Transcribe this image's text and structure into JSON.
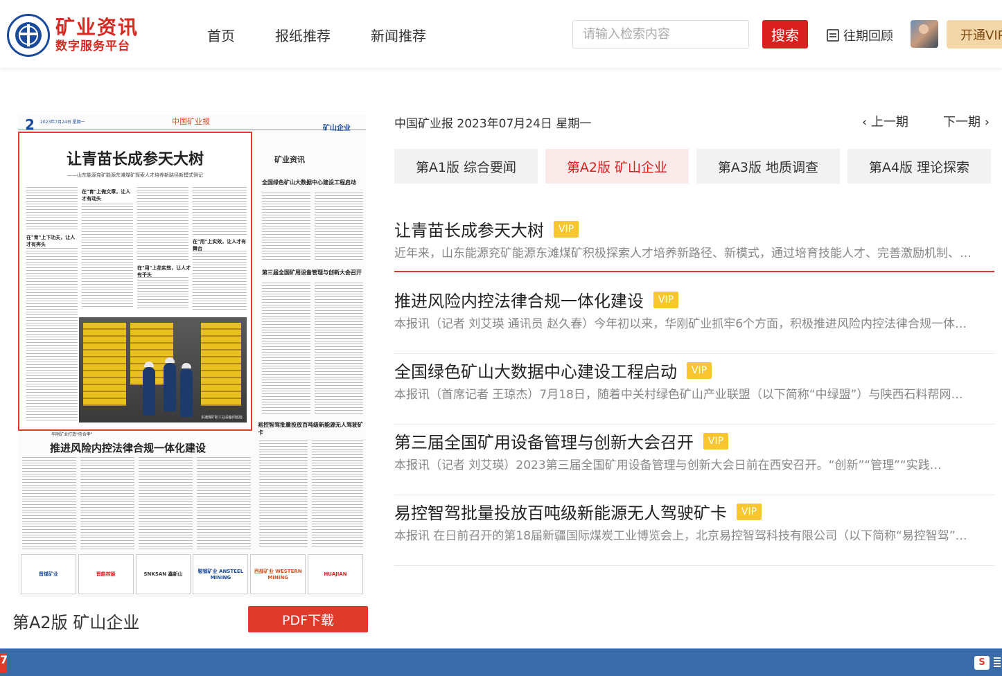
{
  "header": {
    "logo_title": "矿业资讯",
    "logo_sub": "数字服务平台",
    "nav": [
      {
        "label": "首页"
      },
      {
        "label": "报纸推荐"
      },
      {
        "label": "新闻推荐"
      }
    ],
    "search_placeholder": "请输入检索内容",
    "search_button": "搜索",
    "archive_label": "往期回顾",
    "vip_button": "开通VIP"
  },
  "paper": {
    "page_num": "2",
    "date_line": "2023年7月24日  星期一",
    "masthead": "中国矿业报",
    "section_tag": "矿山企业",
    "headline": "让青苗长成参天大树",
    "subhead": "——山东能源兖矿能源东滩煤矿探索人才培养新路径新模式侧记",
    "right_logo": "矿业资讯",
    "right_col_title_1": "全国绿色矿山大数据中心建设工程启动",
    "right_col_title_2": "第三届全国矿用设备管理与创新大会召开",
    "right_col_title_3": "易控智驾批量投放百吨级新能源无人驾驶矿卡",
    "col_head_1": "在\"育\"上做文章，让人才有动头",
    "col_head_2": "在\"育\"上下功夫，让人才有奔头",
    "col_head_3": "在\"用\"上实效，让人才有舞台",
    "col_head_4": "在\"用\"上花实效，让人才有干头",
    "kicker": "华刚矿业打造\"信合率\"",
    "second_headline": "推进风险内控法律合规一体化建设",
    "photo_caption": "东滩煤矿职工在设备间巡检",
    "ads": [
      "晋煤矿业",
      "晋能控股",
      "SNKSAN 鑫新山",
      "鞍钢矿业 ANSTEEL MINING",
      "西部矿业 WESTERN MINING",
      "HUAJIAN"
    ]
  },
  "paper_caption": "第A2版 矿山企业",
  "pdf_button": "PDF下载",
  "issue": {
    "info": "中国矿业报 2023年07月24日 星期一",
    "prev": "上一期",
    "next": "下一期"
  },
  "tabs": [
    {
      "label": "第A1版 综合要闻",
      "active": false
    },
    {
      "label": "第A2版 矿山企业",
      "active": true
    },
    {
      "label": "第A3版 地质调查",
      "active": false
    },
    {
      "label": "第A4版 理论探索",
      "active": false
    }
  ],
  "articles": [
    {
      "title": "让青苗长成参天大树",
      "badge": "VIP",
      "summary": "近年来，山东能源兖矿能源东滩煤矿积极探索人才培养新路径、新模式，通过培育技能人才、完善激励机制、…"
    },
    {
      "title": "推进风险内控法律合规一体化建设",
      "badge": "VIP",
      "summary": "本报讯（记者 刘艾瑛 通讯员 赵久春）今年初以来，华刚矿业抓牢6个方面，积极推进风险内控法律合规一体…"
    },
    {
      "title": "全国绿色矿山大数据中心建设工程启动",
      "badge": "VIP",
      "summary": "本报讯（首席记者 王琼杰）7月18日，随着中关村绿色矿山产业联盟（以下简称“中绿盟”）与陕西石料帮网…"
    },
    {
      "title": "第三届全国矿用设备管理与创新大会召开",
      "badge": "VIP",
      "summary": "本报讯（记者 刘艾瑛）2023第三届全国矿用设备管理与创新大会日前在西安召开。“创新”“管理”“实践…"
    },
    {
      "title": "易控智驾批量投放百吨级新能源无人驾驶矿卡",
      "badge": "VIP",
      "summary": "本报讯 在日前召开的第18届新疆国际煤炭工业博览会上，北京易控智驾科技有限公司（以下简称“易控智驾”…"
    }
  ],
  "taskbar": {
    "left_icon": "7",
    "right_icon": "S"
  }
}
